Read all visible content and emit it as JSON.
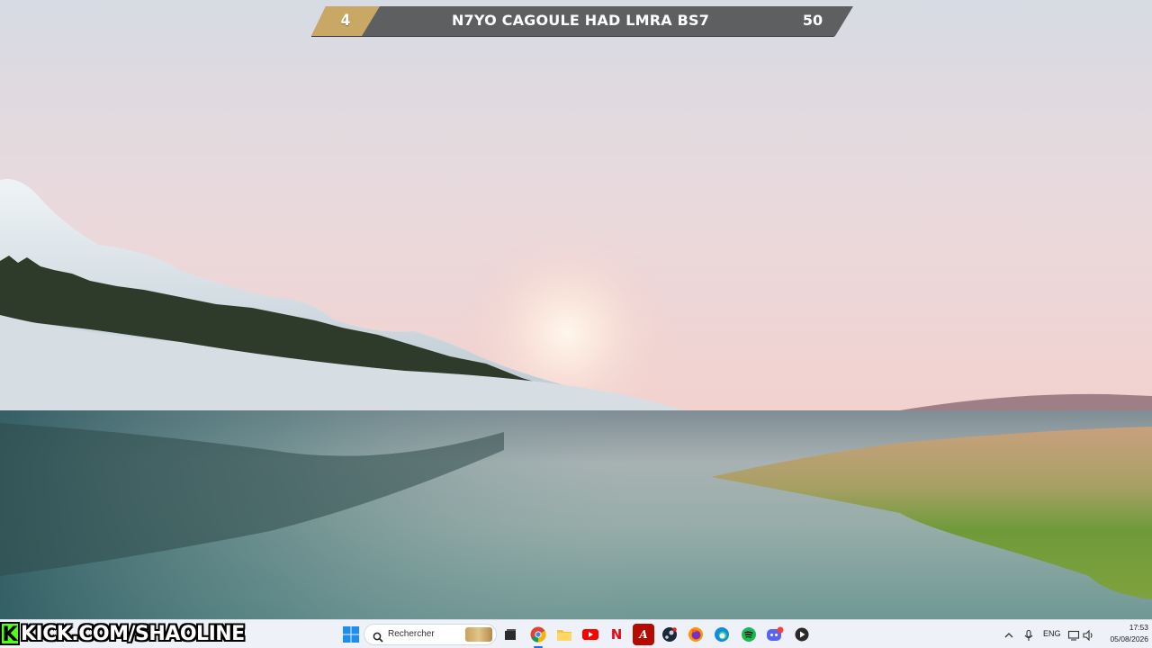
{
  "overlay": {
    "score_bar": {
      "rank": "4",
      "title": "N7YO CAGOULE HAD LMRA BS7",
      "score": "50"
    },
    "kick_banner": {
      "logo_letter": "K",
      "url": "KICK.COM/SHAOLINE",
      "accent": "#53fc18"
    }
  },
  "taskbar": {
    "search_placeholder": "Rechercher",
    "apps": [
      {
        "name": "start",
        "icon": "windows-start-icon"
      },
      {
        "name": "search",
        "icon": "search-icon"
      },
      {
        "name": "task-view",
        "icon": "task-view-icon"
      },
      {
        "name": "chrome",
        "icon": "chrome-icon"
      },
      {
        "name": "file-explorer",
        "icon": "folder-icon"
      },
      {
        "name": "youtube",
        "icon": "youtube-icon"
      },
      {
        "name": "netflix",
        "icon": "netflix-icon",
        "glyph": "N"
      },
      {
        "name": "acrobat",
        "icon": "acrobat-icon",
        "glyph": "A"
      },
      {
        "name": "steam",
        "icon": "steam-icon"
      },
      {
        "name": "firefox",
        "icon": "firefox-icon"
      },
      {
        "name": "edge",
        "icon": "edge-icon"
      },
      {
        "name": "spotify",
        "icon": "spotify-icon"
      },
      {
        "name": "discord",
        "icon": "discord-icon"
      },
      {
        "name": "media-player",
        "icon": "play-icon"
      }
    ],
    "tray": {
      "language": "ENG",
      "time": "17:53",
      "date": "05/08/2026"
    }
  },
  "colors": {
    "score_bar_bg": "#5e5f60",
    "score_bar_accent": "#c9a765",
    "taskbar_bg": "#eef1f7"
  }
}
